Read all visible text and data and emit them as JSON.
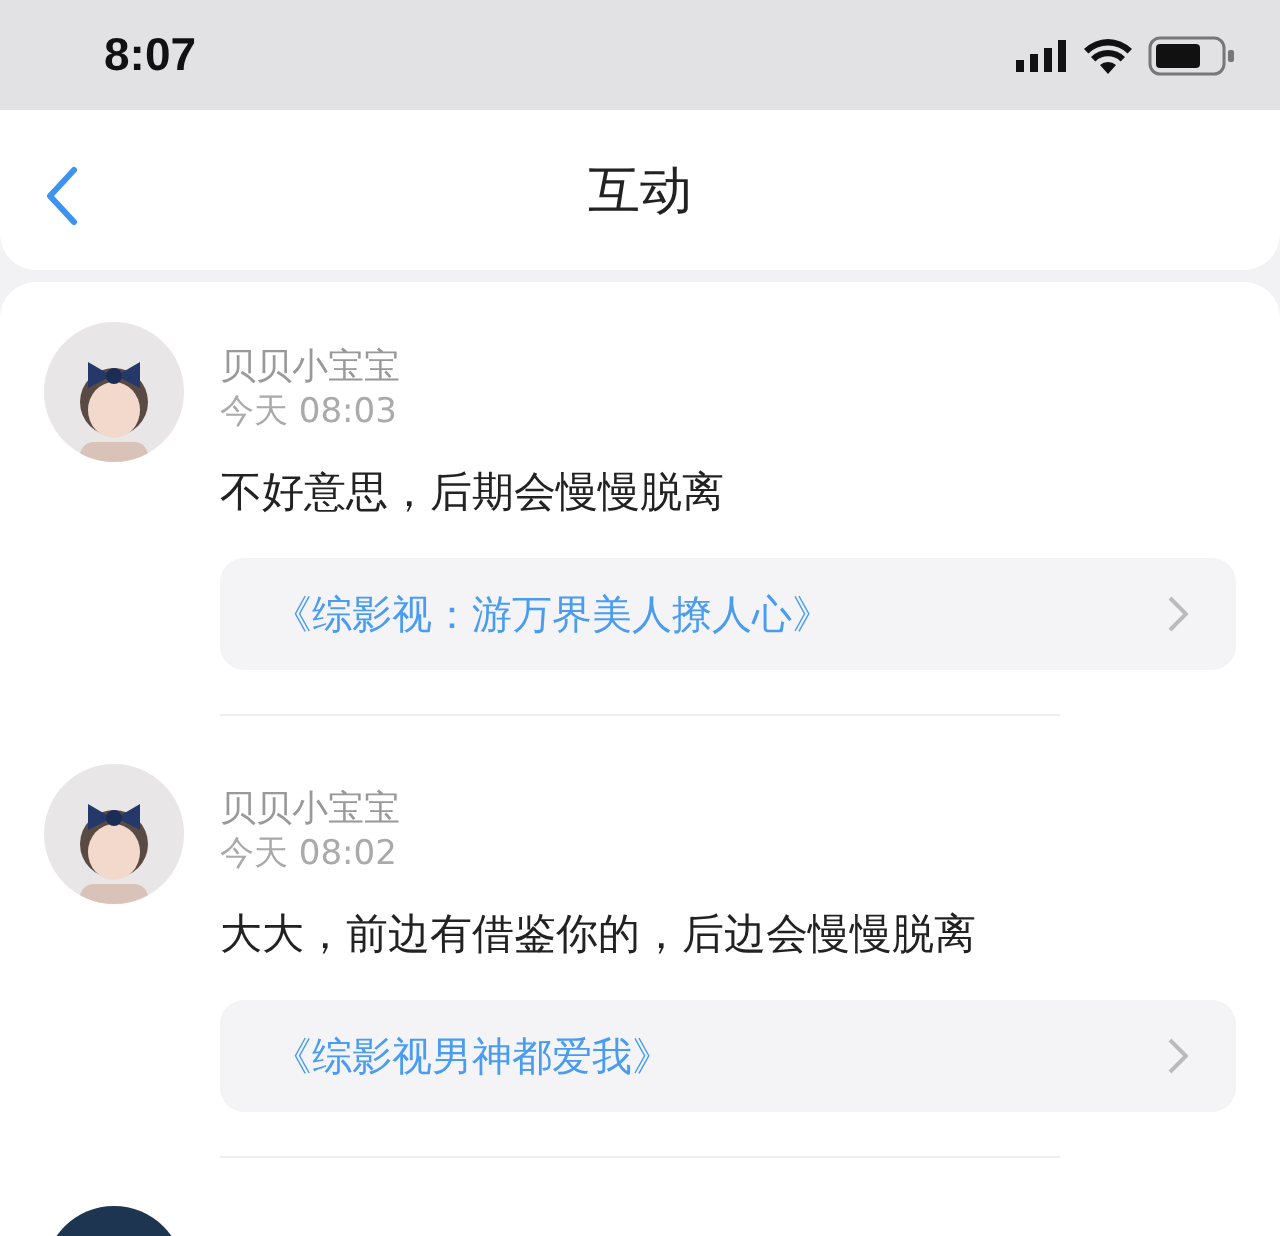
{
  "status_bar": {
    "time": "8:07"
  },
  "header": {
    "title": "互动"
  },
  "comments": [
    {
      "name": "贝贝小宝宝",
      "time": "今天 08:03",
      "text": "不好意思，后期会慢慢脱离",
      "book": "《综影视：游万界美人撩人心》"
    },
    {
      "name": "贝贝小宝宝",
      "time": "今天 08:02",
      "text": "大大，前边有借鉴你的，后边会慢慢脱离",
      "book": "《综影视男神都爱我》"
    }
  ]
}
